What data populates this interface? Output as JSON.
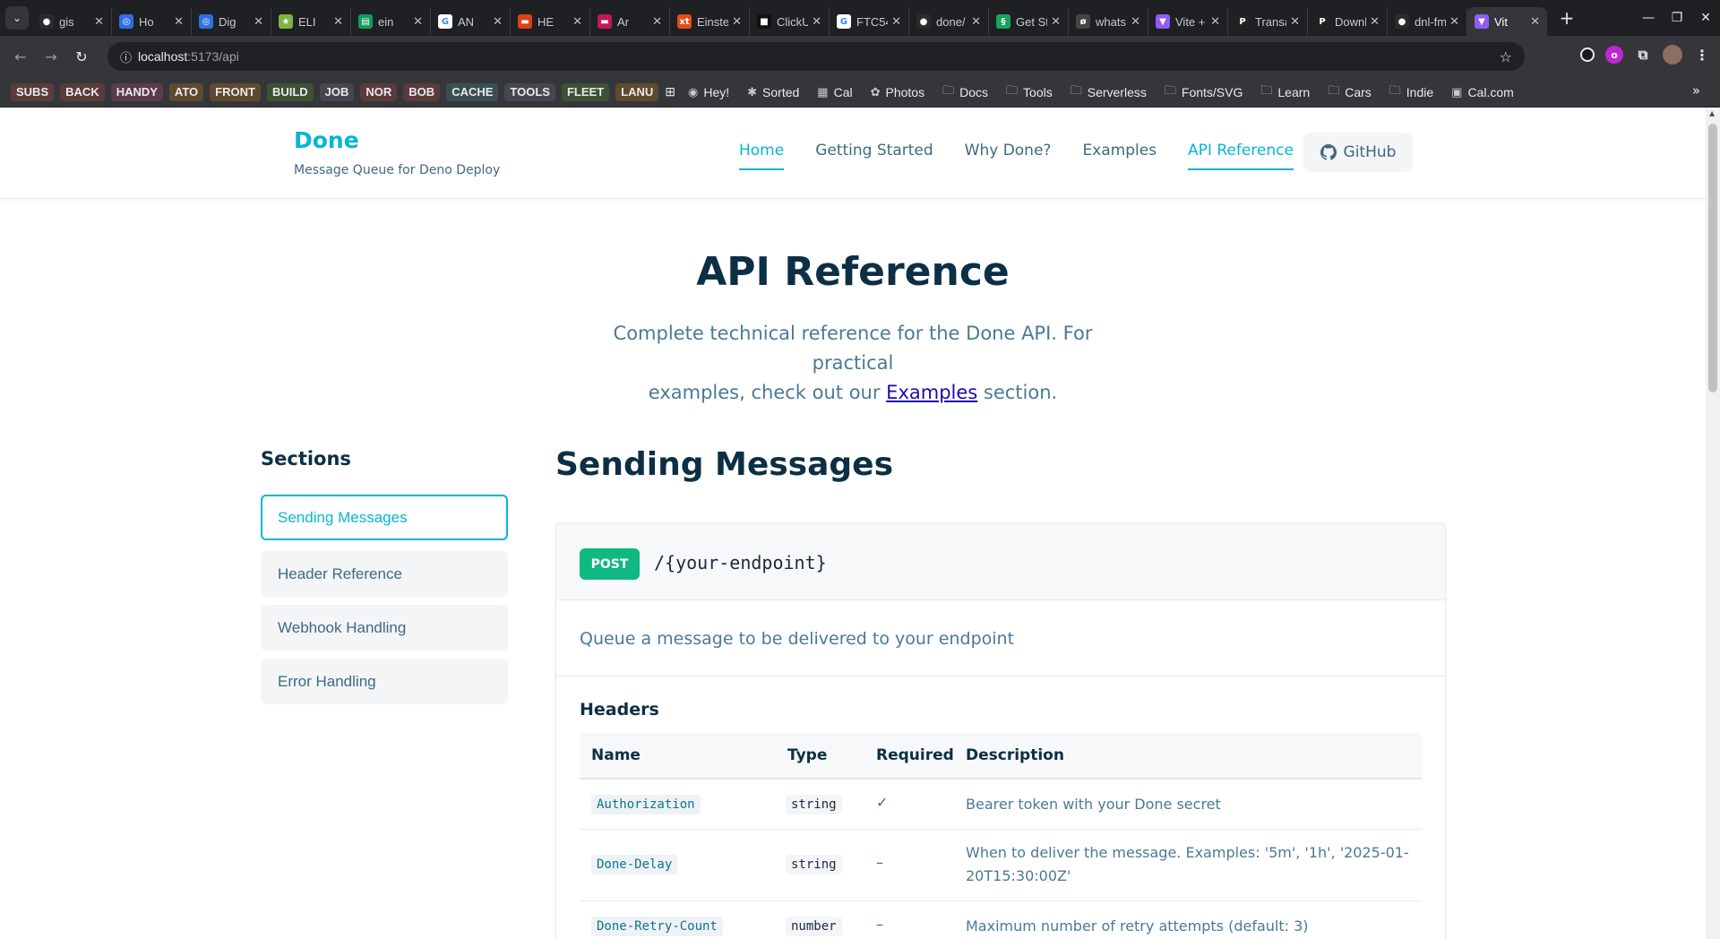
{
  "browser": {
    "tabs": [
      {
        "label": "gis",
        "fav": "github",
        "color": "#2b2b2b"
      },
      {
        "label": "Ho",
        "fav": "ring",
        "color": "#2f6fe0"
      },
      {
        "label": "Dig",
        "fav": "ring",
        "color": "#2f6fe0"
      },
      {
        "label": "ELI",
        "fav": "star",
        "color": "#7cb342"
      },
      {
        "label": "ein",
        "fav": "sheet",
        "color": "#0f9d58"
      },
      {
        "label": "AN",
        "fav": "google",
        "color": "#ffffff"
      },
      {
        "label": "HE",
        "fav": "flag",
        "color": "#d84315"
      },
      {
        "label": "Ar",
        "fav": "flag",
        "color": "#c2185b"
      },
      {
        "label": "Einste",
        "fav": "xt",
        "color": "#e64a19"
      },
      {
        "label": "ClickU",
        "fav": "square",
        "color": "#111111"
      },
      {
        "label": "FTC54",
        "fav": "google",
        "color": "#ffffff"
      },
      {
        "label": "done/",
        "fav": "github",
        "color": "#2b2b2b"
      },
      {
        "label": "Get St",
        "fav": "swirl",
        "color": "#1aa260"
      },
      {
        "label": "whats",
        "fav": "cow",
        "color": "#444444"
      },
      {
        "label": "Vite +",
        "fav": "vite",
        "color": "#8e5cf7"
      },
      {
        "label": "Transa",
        "fav": "paypal",
        "color": "#222222"
      },
      {
        "label": "Downl",
        "fav": "paypal",
        "color": "#222222"
      },
      {
        "label": "dnl-fm",
        "fav": "github",
        "color": "#2b2b2b"
      },
      {
        "label": "Vit",
        "fav": "vite",
        "color": "#8e5cf7",
        "active": true
      }
    ],
    "new_tab": "+",
    "url_host": "localhost",
    "url_path": ":5173/api",
    "bookmark_chips": [
      {
        "label": "SUBS",
        "bg": "#5c3b3b"
      },
      {
        "label": "BACK",
        "bg": "#5c3b3b"
      },
      {
        "label": "HANDY",
        "bg": "#5c3b4a"
      },
      {
        "label": "ATO",
        "bg": "#5e4a2c"
      },
      {
        "label": "FRONT",
        "bg": "#5e4a2c"
      },
      {
        "label": "BUILD",
        "bg": "#3d5233"
      },
      {
        "label": "JOB",
        "bg": "#44474d"
      },
      {
        "label": "NOR",
        "bg": "#5c3b3b"
      },
      {
        "label": "BOB",
        "bg": "#5c3b3b"
      },
      {
        "label": "CACHE",
        "bg": "#3b4f52"
      },
      {
        "label": "TOOLS",
        "bg": "#44474d"
      },
      {
        "label": "FLEET",
        "bg": "#3d5233"
      },
      {
        "label": "LANU",
        "bg": "#5e4a2c"
      }
    ],
    "bookmarks": [
      {
        "label": "Hey!",
        "icon": "◉"
      },
      {
        "label": "Sorted",
        "icon": "✱"
      },
      {
        "label": "Cal",
        "icon": "▦"
      },
      {
        "label": "Photos",
        "icon": "✿"
      },
      {
        "label": "Docs",
        "icon": "🗀"
      },
      {
        "label": "Tools",
        "icon": "🗀"
      },
      {
        "label": "Serverless",
        "icon": "🗀"
      },
      {
        "label": "Fonts/SVG",
        "icon": "🗀"
      },
      {
        "label": "Learn",
        "icon": "🗀"
      },
      {
        "label": "Cars",
        "icon": "🗀"
      },
      {
        "label": "Indie",
        "icon": "🗀"
      },
      {
        "label": "Cal.com",
        "icon": "▣"
      }
    ]
  },
  "site": {
    "brand_title": "Done",
    "brand_sub": "Message Queue for Deno Deploy",
    "nav": [
      "Home",
      "Getting Started",
      "Why Done?",
      "Examples",
      "API Reference"
    ],
    "github_label": "GitHub"
  },
  "hero": {
    "title": "API Reference",
    "sub_line1": "Complete technical reference for the Done API. For practical",
    "sub_line2_pre": "examples, check out our ",
    "sub_link": "Examples",
    "sub_line2_post": " section."
  },
  "sidebar": {
    "title": "Sections",
    "items": [
      "Sending Messages",
      "Header Reference",
      "Webhook Handling",
      "Error Handling"
    ]
  },
  "main": {
    "section_title": "Sending Messages",
    "method": "POST",
    "endpoint": "/{your-endpoint}",
    "description": "Queue a message to be delivered to your endpoint",
    "headers_title": "Headers",
    "columns": [
      "Name",
      "Type",
      "Required",
      "Description"
    ],
    "rows": [
      {
        "name": "Authorization",
        "type": "string",
        "required": "✓",
        "description": "Bearer token with your Done secret"
      },
      {
        "name": "Done-Delay",
        "type": "string",
        "required": "–",
        "description": "When to deliver the message. Examples: '5m', '1h', '2025-01-20T15:30:00Z'"
      },
      {
        "name": "Done-Retry-Count",
        "type": "number",
        "required": "–",
        "description": "Maximum number of retry attempts (default: 3)"
      }
    ]
  }
}
